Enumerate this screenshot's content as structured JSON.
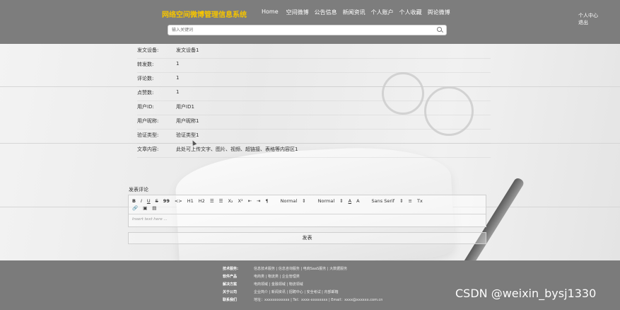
{
  "header": {
    "site_title": "网络空间微博管理信息系统",
    "nav": [
      "Home",
      "空间微博",
      "公告信息",
      "新闻资讯",
      "个人账户",
      "个人收藏",
      "舆论微博"
    ],
    "user_links": [
      "个人中心",
      "退出"
    ],
    "search": {
      "placeholder": "输入关键词"
    }
  },
  "detail": {
    "rows": [
      {
        "label": "发文设备:",
        "value": "发文设备1"
      },
      {
        "label": "转发数:",
        "value": "1"
      },
      {
        "label": "评论数:",
        "value": "1"
      },
      {
        "label": "点赞数:",
        "value": "1"
      },
      {
        "label": "用户ID:",
        "value": "用户ID1"
      },
      {
        "label": "用户昵称:",
        "value": "用户昵称1"
      },
      {
        "label": "验证类型:",
        "value": "验证类型1"
      },
      {
        "label": "文章内容:",
        "value": "此处可上传文字、图片、视频、超链接、表格等内容区1"
      }
    ]
  },
  "comment": {
    "label": "发表评论",
    "toolbar": {
      "bold": "B",
      "italic": "I",
      "underline": "U",
      "strike": "S",
      "quote": "99",
      "code": "<>",
      "h1": "H1",
      "h2": "H2",
      "ol": "☰",
      "ul": "☰",
      "sub": "X₂",
      "sup": "X²",
      "indent_less": "⇤",
      "indent_more": "⇥",
      "direction": "¶",
      "size": "Normal",
      "header": "Normal",
      "color": "A",
      "background": "A",
      "font": "Sans Serif",
      "align": "≡",
      "clean": "Tx",
      "link": "🔗",
      "image": "▣",
      "video": "▤"
    },
    "placeholder": "Insert text here ...",
    "submit_label": "发表"
  },
  "footer": {
    "rows": [
      {
        "key": "技术服务:",
        "value": "信息技术服务 | 信息咨询服务 | 电商SaaS服务 | 大数据服务"
      },
      {
        "key": "软件产品",
        "value": "电商类 | 物流类 | 企业管理类"
      },
      {
        "key": "解决方案",
        "value": "电商领域 | 金融领域 | 物流领域"
      },
      {
        "key": "关于公司",
        "value": "企业简介 | 新闻资讯 | 招聘中心 | 安全考试 | 内部邮箱"
      },
      {
        "key": "联系我们",
        "value": "地址：xxxxxxxxxxxx | Tel：xxxx-xxxxxxxx | Email：xxxx@xxxxxx.com.cn"
      }
    ]
  },
  "watermark": "CSDN @weixin_bysj1330"
}
